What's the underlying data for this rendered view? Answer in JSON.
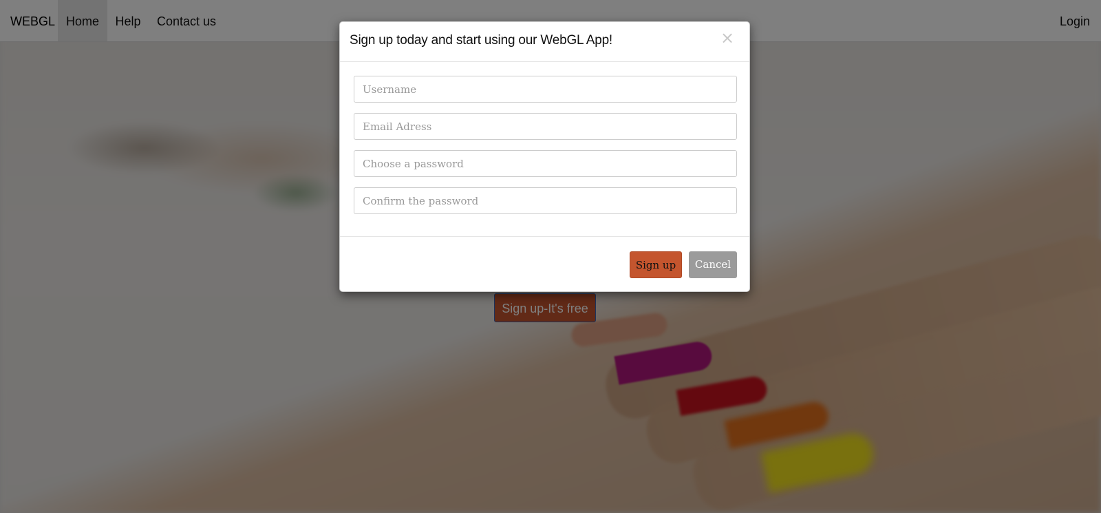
{
  "navbar": {
    "brand": "WEBGL",
    "links": [
      {
        "label": "Home",
        "active": true
      },
      {
        "label": "Help"
      },
      {
        "label": "Contact us"
      }
    ],
    "login_label": "Login"
  },
  "hero": {
    "cta_label": "Sign up-It's free"
  },
  "modal": {
    "title": "Sign up today and start using our WebGL App!",
    "close_symbol": "×",
    "fields": {
      "username": {
        "placeholder": "Username",
        "value": ""
      },
      "email": {
        "placeholder": "Email Adress",
        "value": ""
      },
      "password": {
        "placeholder": "Choose a password",
        "value": ""
      },
      "confirm": {
        "placeholder": "Confirm the password",
        "value": ""
      }
    },
    "signup_label": "Sign up",
    "cancel_label": "Cancel"
  },
  "colors": {
    "accent": "#c4552e",
    "cancel": "#9b9b9b",
    "backdrop": "rgba(0,0,0,0.5)"
  }
}
